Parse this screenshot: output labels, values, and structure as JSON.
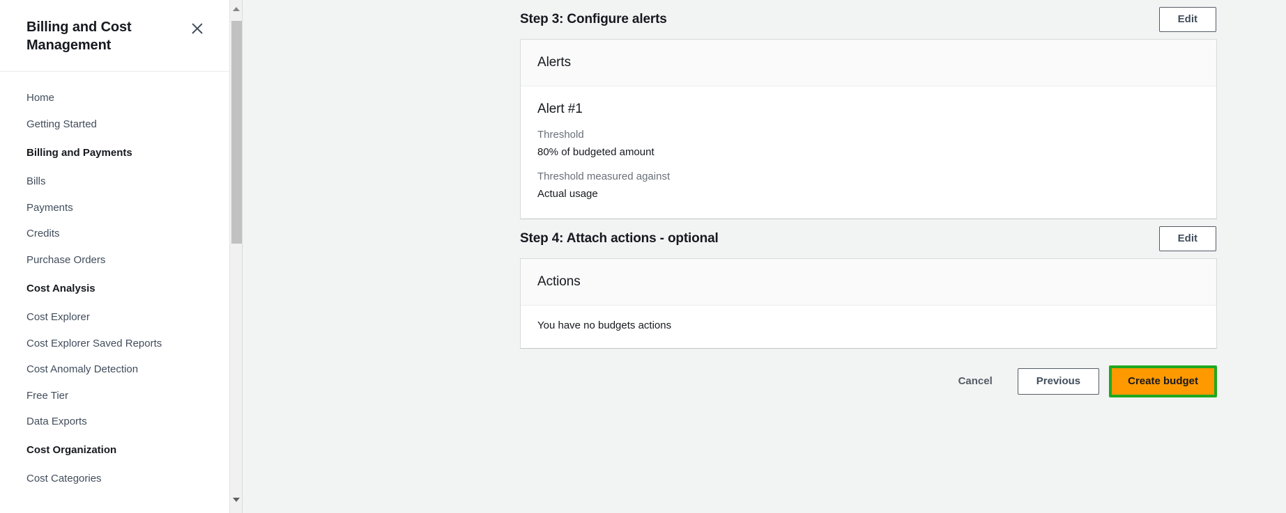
{
  "sidebar": {
    "title": "Billing and Cost Management",
    "close_icon": "close-icon",
    "items": [
      {
        "label": "Home",
        "type": "link"
      },
      {
        "label": "Getting Started",
        "type": "link"
      },
      {
        "label": "Billing and Payments",
        "type": "section"
      },
      {
        "label": "Bills",
        "type": "link"
      },
      {
        "label": "Payments",
        "type": "link"
      },
      {
        "label": "Credits",
        "type": "link"
      },
      {
        "label": "Purchase Orders",
        "type": "link"
      },
      {
        "label": "Cost Analysis",
        "type": "section"
      },
      {
        "label": "Cost Explorer",
        "type": "link"
      },
      {
        "label": "Cost Explorer Saved Reports",
        "type": "link"
      },
      {
        "label": "Cost Anomaly Detection",
        "type": "link"
      },
      {
        "label": "Free Tier",
        "type": "link"
      },
      {
        "label": "Data Exports",
        "type": "link"
      },
      {
        "label": "Cost Organization",
        "type": "section"
      },
      {
        "label": "Cost Categories",
        "type": "link"
      }
    ],
    "scrollbar": {
      "up_icon": "chevron-up-icon",
      "down_icon": "chevron-down-icon"
    }
  },
  "steps": {
    "step3": {
      "title": "Step 3: Configure alerts",
      "edit_label": "Edit",
      "card_title": "Alerts",
      "alert": {
        "name": "Alert #1",
        "threshold_label": "Threshold",
        "threshold_value": "80% of budgeted amount",
        "measured_label": "Threshold measured against",
        "measured_value": "Actual usage"
      }
    },
    "step4": {
      "title": "Step 4: Attach actions - optional",
      "edit_label": "Edit",
      "card_title": "Actions",
      "empty_text": "You have no budgets actions"
    }
  },
  "footer": {
    "cancel_label": "Cancel",
    "previous_label": "Previous",
    "create_label": "Create budget"
  },
  "colors": {
    "accent_orange": "#ff9900",
    "highlight_green": "#1fa91f",
    "page_background": "#f2f3f3",
    "label_gray": "#687078"
  }
}
